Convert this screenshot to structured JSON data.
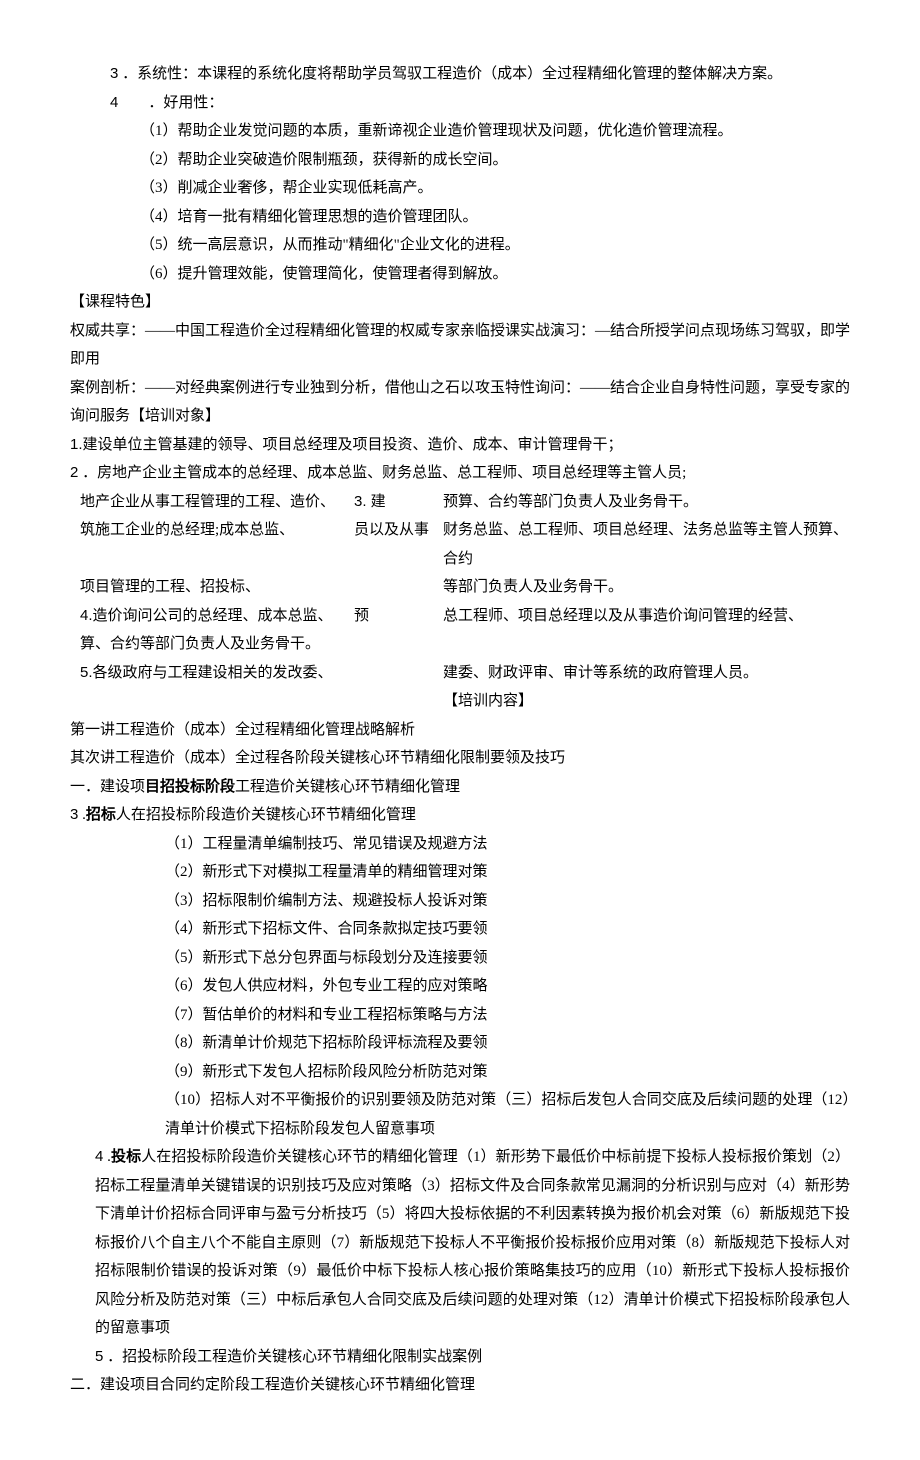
{
  "top": {
    "n3": "3",
    "l3": " ．系统性：本课程的系统化度将帮助学员驾驭工程造价（成本）全过程精细化管理的整体解决方案。",
    "n4": "4",
    "l4": "　　．好用性：",
    "u1": "（1）帮助企业发觉问题的本质，重新谛视企业造价管理现状及问题，优化造价管理流程。",
    "u2": "（2）帮助企业突破造价限制瓶颈，获得新的成长空间。",
    "u3": "（3）削减企业奢侈，帮企业实现低耗高产。",
    "u4": "（4）培育一批有精细化管理思想的造价管理团队。",
    "u5": "（5）统一高层意识，从而推动\"精细化\"企业文化的进程。",
    "u6": "（6）提升管理效能，使管理简化，使管理者得到解放。"
  },
  "sec": {
    "kcts": "【课程特色】",
    "s1": "权威共享：——中国工程造价全过程精细化管理的权威专家亲临授课实战演习：—结合所授学问点现场练习驾驭，即学即用",
    "s2": "案例剖析：——对经典案例进行专业独到分析，借他山之石以攻玉特性询问：——结合企业自身特性问题，享受专家的询问服务【培训对象】",
    "t1n": "1.",
    "t1": "建设单位主管基建的领导、项目总经理及项目投资、造价、成本、审计管理骨干；",
    "t2n": "2",
    "t2": " ．房地产企业主管成本的总经理、成本总监、财务总监、总工程师、项目总经理等主管人员;"
  },
  "grid": {
    "a1": " 地产企业从事工程管理的工程、造价、",
    "b1": "3. 建",
    "c1": "预算、合约等部门负责人及业务骨干。",
    "a2": " 筑施工企业的总经理;成本总监、",
    "b2": "员以及从事",
    "c2": "财务总监、总工程师、项目总经理、法务总监等主管人预算、合约",
    "a3": "项目管理的工程、招投标、",
    "c3": "等部门负责人及业务骨干。",
    "a4n": "4.",
    "a4": "造价询问公司的总经理、成本总监、",
    "b4": "预",
    "c4": "总工程师、项目总经理以及从事造价询问管理的经营、",
    "a5": " 算、合约等部门负责人及业务骨干。",
    "a6n": "5.",
    "a6": "各级政府与工程建设相关的发改委、",
    "c6": "建委、财政评审、审计等系统的政府管理人员。",
    "c7": "【培训内容】"
  },
  "out": {
    "p1": "第一讲工程造价（成本）全过程精细化管理战略解析",
    "p2": "其次讲工程造价（成本）全过程各阶段关键核心环节精细化限制要领及技巧",
    "p3a": "一．建设项",
    "p3b": "目招投标阶段",
    "p3c": "工程造价关键核心环节精细化管理",
    "p4n": "3",
    "p4a": " .",
    "p4b": "招标",
    "p4c": "人在招投标阶段造价关键核心环节精细化管理",
    "i1": "（1）工程量清单编制技巧、常见错误及规避方法",
    "i2": "（2）新形式下对模拟工程量清单的精细管理对策",
    "i3": "（3）招标限制价编制方法、规避投标人投诉对策",
    "i4": "（4）新形式下招标文件、合同条款拟定技巧要领",
    "i5": "（5）新形式下总分包界面与标段划分及连接要领",
    "i6": "（6）发包人供应材料，外包专业工程的应对策略",
    "i7": "（7）暂估单价的材料和专业工程招标策略与方法",
    "i8": "（8）新清单计价规范下招标阶段评标流程及要领",
    "i9": "（9）新形式下发包人招标阶段风险分析防范对策",
    "i10": "（10）招标人对不平衡报价的识别要领及防范对策（三）招标后发包人合同交底及后续问题的处理（12）清单计价模式下招标阶段发包人留意事项",
    "p5n": "4",
    "p5a": " .",
    "p5b": "投标",
    "p5c": "人在招投标阶段造价关键核心环节的精细化管理（1）新形势下最低价中标前提下投标人投标报价策划（2）招标工程量清单关键错误的识别技巧及应对策略（3）招标文件及合同条款常见漏洞的分析识别与应对（4）新形势下清单计价招标合同评审与盈亏分析技巧（5）将四大投标依据的不利因素转换为报价机会对策（6）新版规范下投标报价八个自主八个不能自主原则（7）新版规范下投标人不平衡报价投标报价应用对策（8）新版规范下投标人对招标限制价错误的投诉对策（9）最低价中标下投标人核心报价策略集技巧的应用（10）新形式下投标人投标报价风险分析及防范对策（三）中标后承包人合同交底及后续问题的处理对策（12）清单计价模式下招投标阶段承包人的留意事项",
    "p6n": "5",
    "p6": " ．招投标阶段工程造价关键核心环节精细化限制实战案例",
    "p7": "二．建设项目合同约定阶段工程造价关键核心环节精细化管理"
  }
}
